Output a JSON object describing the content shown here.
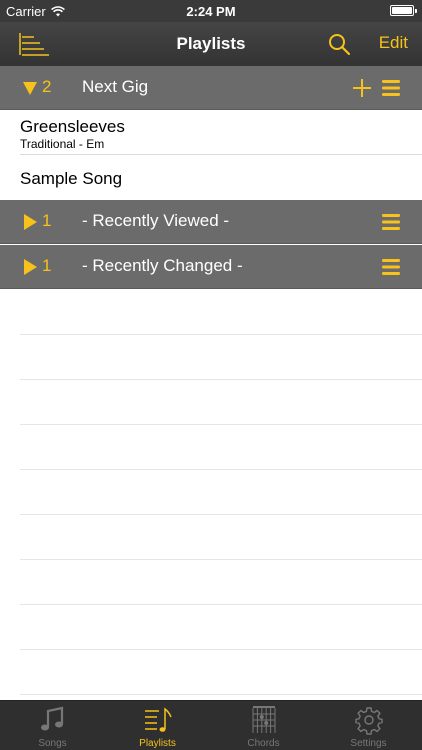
{
  "status_bar": {
    "carrier": "Carrier",
    "time": "2:24 PM",
    "battery_level": 1.0
  },
  "nav_bar": {
    "title": "Playlists",
    "edit_label": "Edit",
    "icons": [
      "playlist-menu-icon",
      "search-icon"
    ]
  },
  "playlists": [
    {
      "count": "2",
      "name": "Next Gig",
      "expanded": true,
      "songs": [
        {
          "title": "Greensleeves",
          "subtitle": "Traditional - Em"
        },
        {
          "title": "Sample Song",
          "subtitle": ""
        }
      ]
    },
    {
      "count": "1",
      "name": "- Recently Viewed -",
      "expanded": false
    },
    {
      "count": "1",
      "name": "- Recently Changed -",
      "expanded": false
    }
  ],
  "tab_bar": {
    "tabs": [
      {
        "label": "Songs",
        "icon": "music-note-icon",
        "selected": false
      },
      {
        "label": "Playlists",
        "icon": "playlist-icon",
        "selected": true
      },
      {
        "label": "Chords",
        "icon": "chord-grid-icon",
        "selected": false
      },
      {
        "label": "Settings",
        "icon": "gear-icon",
        "selected": false
      }
    ]
  },
  "colors": {
    "accent": "#f6c21b",
    "header_bg": "#6b6b6b",
    "nav_bg": "#3a3a3a",
    "tab_inactive": "#777777"
  }
}
